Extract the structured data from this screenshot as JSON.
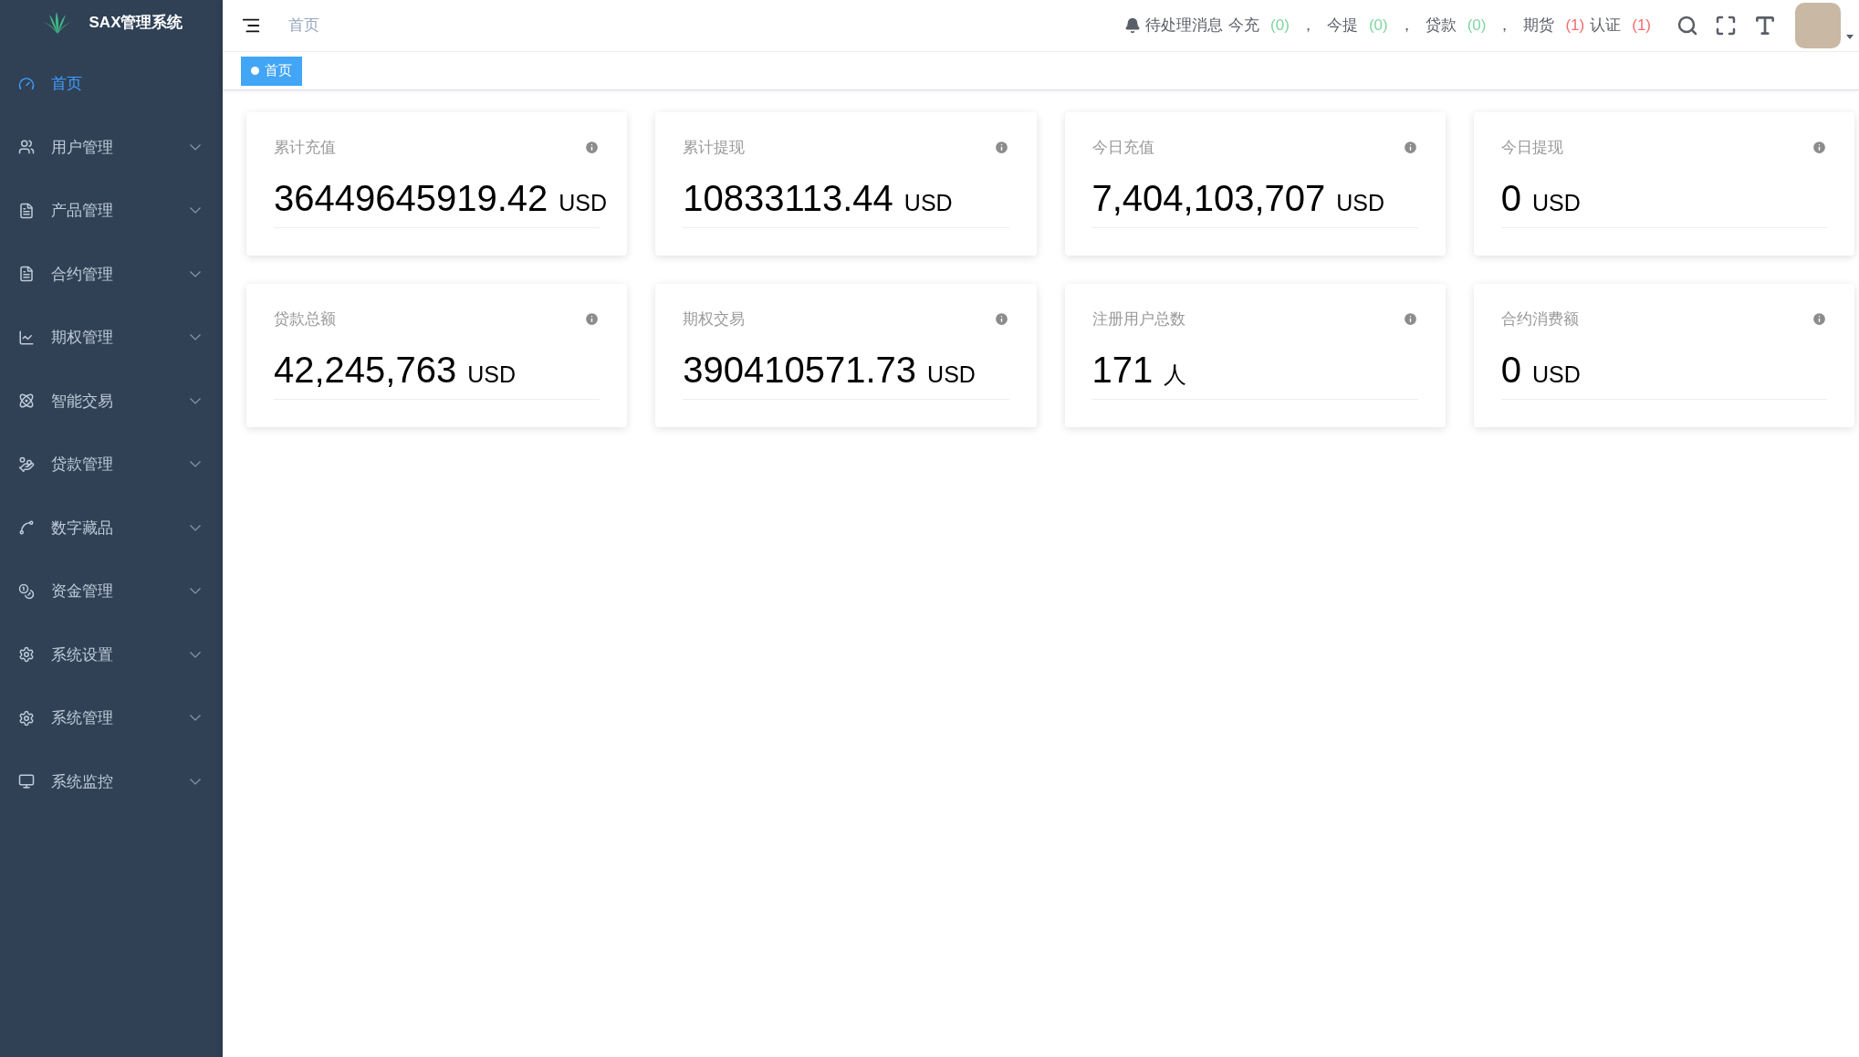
{
  "brand": {
    "title": "SAX管理系统"
  },
  "sidebar": {
    "items": [
      {
        "label": "首页",
        "selected": true,
        "expandable": false
      },
      {
        "label": "用户管理",
        "selected": false,
        "expandable": true
      },
      {
        "label": "产品管理",
        "selected": false,
        "expandable": true
      },
      {
        "label": "合约管理",
        "selected": false,
        "expandable": true
      },
      {
        "label": "期权管理",
        "selected": false,
        "expandable": true
      },
      {
        "label": "智能交易",
        "selected": false,
        "expandable": true
      },
      {
        "label": "贷款管理",
        "selected": false,
        "expandable": true
      },
      {
        "label": "数字藏品",
        "selected": false,
        "expandable": true
      },
      {
        "label": "资金管理",
        "selected": false,
        "expandable": true
      },
      {
        "label": "系统设置",
        "selected": false,
        "expandable": true
      },
      {
        "label": "系统管理",
        "selected": false,
        "expandable": true
      },
      {
        "label": "系统监控",
        "selected": false,
        "expandable": true
      }
    ]
  },
  "header": {
    "breadcrumb": "首页",
    "notice_title": "待处理消息",
    "notices": [
      {
        "label": "今充",
        "count": "(0)",
        "color": "#7ed6a0",
        "separator": "，"
      },
      {
        "label": "今提",
        "count": "(0)",
        "color": "#7ed6a0",
        "separator": "，"
      },
      {
        "label": "贷款",
        "count": "(0)",
        "color": "#7ed6a0",
        "separator": "，"
      },
      {
        "label": "期货",
        "count": "(1)",
        "color": "#f56c6c"
      },
      {
        "label": "认证",
        "count": "(1)",
        "color": "#f56c6c"
      }
    ]
  },
  "tabs": [
    {
      "label": "首页",
      "selected": true
    }
  ],
  "cards": [
    {
      "title": "累计充值",
      "value": "36449645919.42",
      "unit": "USD"
    },
    {
      "title": "累计提现",
      "value": "10833113.44",
      "unit": "USD"
    },
    {
      "title": "今日充值",
      "value": "7,404,103,707",
      "unit": "USD"
    },
    {
      "title": "今日提现",
      "value": "0",
      "unit": "USD"
    },
    {
      "title": "贷款总额",
      "value": "42,245,763",
      "unit": "USD"
    },
    {
      "title": "期权交易",
      "value": "390410571.73",
      "unit": "USD"
    },
    {
      "title": "注册用户总数",
      "value": "171",
      "unit": "人"
    },
    {
      "title": "合约消费额",
      "value": "0",
      "unit": "USD"
    }
  ]
}
